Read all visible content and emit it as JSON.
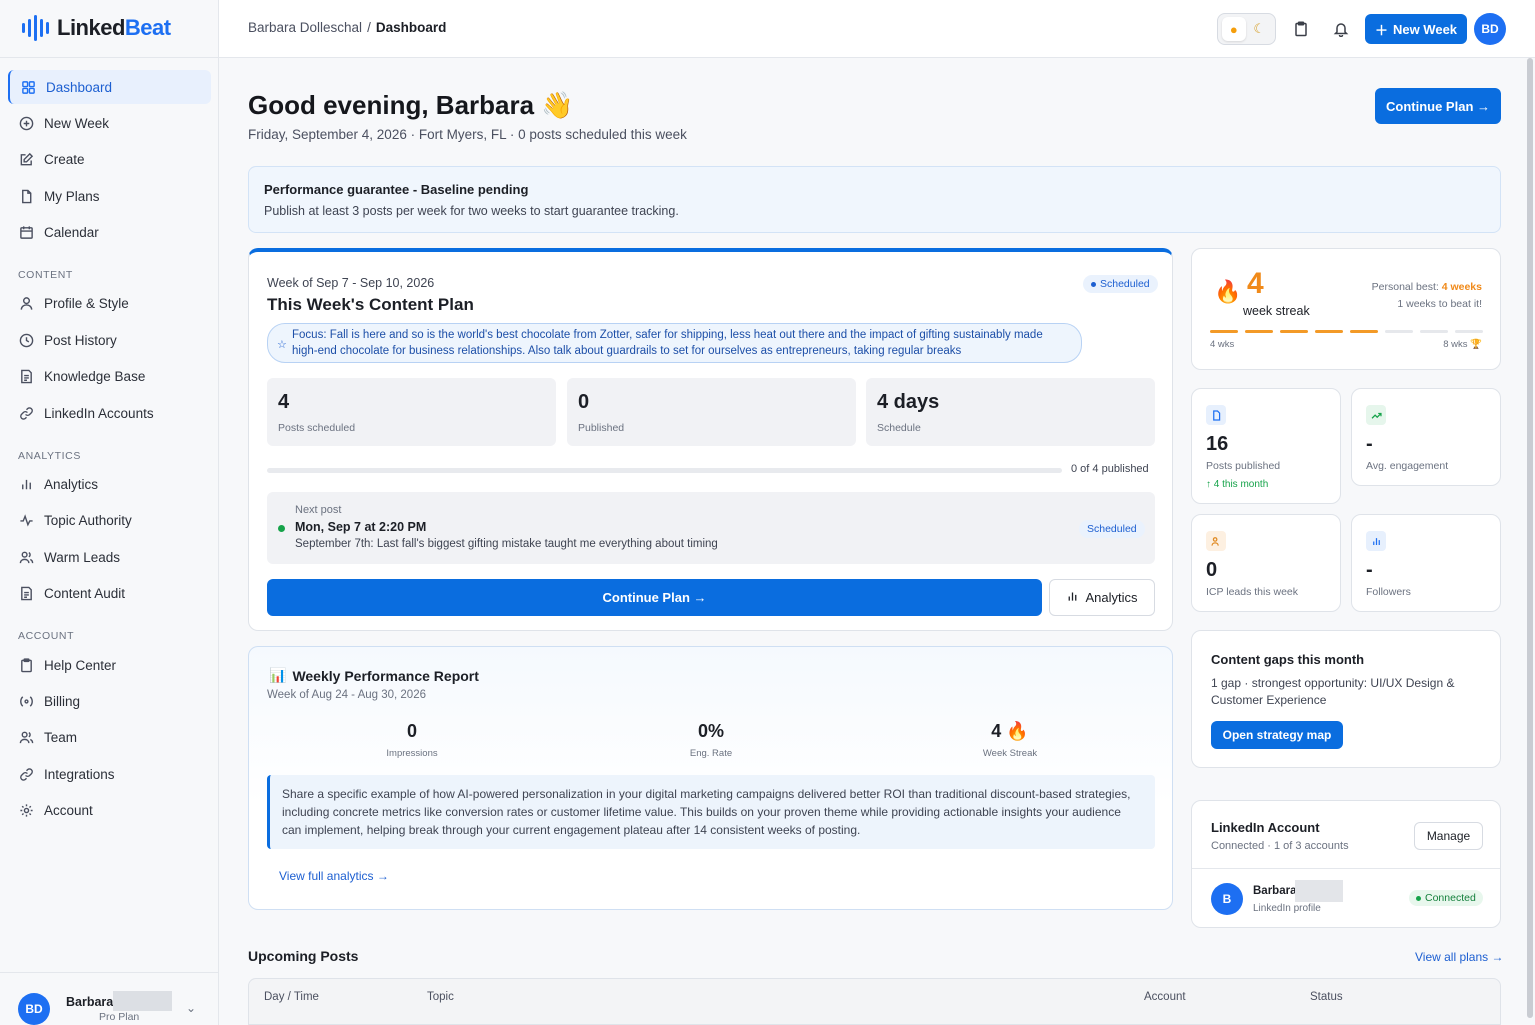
{
  "app": {
    "logo_text": "Linked",
    "logo_accent": "Beat"
  },
  "colors": {
    "accent": "#0a6ddf",
    "streak": "#f08a1a",
    "success": "#16a34a"
  },
  "sidebar": {
    "items": [
      {
        "label": "Dashboard",
        "icon": "grid-icon"
      },
      {
        "label": "New Week",
        "icon": "plus-circle-icon"
      },
      {
        "label": "Create",
        "icon": "edit-icon"
      },
      {
        "label": "My Plans",
        "icon": "document-icon"
      },
      {
        "label": "Calendar",
        "icon": "calendar-icon"
      }
    ],
    "content_section": "CONTENT",
    "content_items": [
      {
        "label": "Profile & Style",
        "icon": "user-icon"
      },
      {
        "label": "Post History",
        "icon": "clock-icon"
      },
      {
        "label": "Knowledge Base",
        "icon": "book-icon"
      },
      {
        "label": "LinkedIn Accounts",
        "icon": "link-icon"
      }
    ],
    "analytics_section": "ANALYTICS",
    "analytics_items": [
      {
        "label": "Analytics",
        "icon": "bar-chart-icon"
      },
      {
        "label": "Topic Authority",
        "icon": "activity-icon"
      },
      {
        "label": "Warm Leads",
        "icon": "users-icon"
      },
      {
        "label": "Content Audit",
        "icon": "file-text-icon"
      }
    ],
    "account_section": "ACCOUNT",
    "account_items": [
      {
        "label": "Help Center",
        "icon": "clipboard-icon"
      },
      {
        "label": "Billing",
        "icon": "billing-icon"
      },
      {
        "label": "Team",
        "icon": "team-icon"
      },
      {
        "label": "Integrations",
        "icon": "link-icon"
      },
      {
        "label": "Account",
        "icon": "gear-icon"
      }
    ],
    "user": {
      "initials": "BD",
      "name": "Barbara",
      "plan": "Pro Plan"
    }
  },
  "topbar": {
    "breadcrumb_parent": "Barbara Dolleschal",
    "breadcrumb_sep": "/",
    "breadcrumb_current": "Dashboard",
    "new_week_label": "New Week",
    "avatar_initials": "BD"
  },
  "main": {
    "greeting": "Good evening, Barbara 👋",
    "subtitle": "Friday, September 4, 2026 · Fort Myers, FL · 0 posts scheduled this week",
    "continue_plan": "Continue Plan →",
    "guarantee": {
      "title": "Performance guarantee - Baseline pending",
      "text": "Publish at least 3 posts per week for two weeks to start guarantee tracking."
    },
    "plan": {
      "week": "Week of Sep 7 - Sep 10, 2026",
      "title": "This Week's Content Plan",
      "status": "Scheduled",
      "focus": "Focus: Fall is here and so is the world's best chocolate from Zotter, safer for shipping, less heat out there and the impact of gifting sustainably made high-end chocolate for business relationships. Also talk about guardrails to set for ourselves as entrepreneurs, taking regular breaks",
      "stats": [
        {
          "value": "4",
          "label": "Posts scheduled"
        },
        {
          "value": "0",
          "label": "Published"
        },
        {
          "value": "4 days",
          "label": "Schedule"
        }
      ],
      "progress": 0,
      "progress_label": "0 of 4 published",
      "next_post_label": "Next post",
      "next_post_time": "Mon, Sep 7 at 2:20 PM",
      "next_post_desc": "September 7th: Last fall's biggest gifting mistake taught me everything about timing",
      "next_post_status": "Scheduled",
      "continue_label": "Continue Plan →",
      "analytics_label": "Analytics"
    },
    "report": {
      "title": "Weekly Performance Report",
      "week": "Week of Aug 24 - Aug 30, 2026",
      "metrics": [
        {
          "value": "0",
          "label": "Impressions"
        },
        {
          "value": "0%",
          "label": "Eng. Rate"
        },
        {
          "value": "4 🔥",
          "label": "Week Streak"
        }
      ],
      "insight": "Share a specific example of how AI-powered personalization in your digital marketing campaigns delivered better ROI than traditional discount-based strategies, including concrete metrics like conversion rates or customer lifetime value. This builds on your proven theme while providing actionable insights your audience can implement, helping break through your current engagement plateau after 14 consistent weeks of posting.",
      "view_full": "View full analytics →"
    },
    "streak": {
      "value": "4",
      "label": "week streak",
      "best_prefix": "Personal best: ",
      "best_value": "4 weeks",
      "beat": "1 weeks to beat it!",
      "filled": 5,
      "total": 8,
      "axis_left": "4 wks",
      "axis_right": "8 wks 🏆"
    },
    "mini_stats": [
      {
        "value": "16",
        "label": "Posts published",
        "sub": "↑ 4 this month",
        "icon": "document-icon"
      },
      {
        "value": "-",
        "label": "Avg. engagement",
        "icon": "trending-up-icon"
      },
      {
        "value": "0",
        "label": "ICP leads this week",
        "icon": "users-icon"
      },
      {
        "value": "-",
        "label": "Followers",
        "icon": "bar-chart-icon"
      }
    ],
    "gaps": {
      "title": "Content gaps this month",
      "desc": "1 gap · strongest opportunity: UI/UX Design & Customer Experience",
      "button": "Open strategy map"
    },
    "linkedin": {
      "title": "LinkedIn Account",
      "subtitle": "Connected · 1 of 3 accounts",
      "manage": "Manage",
      "initial": "B",
      "name": "Barbara",
      "profile": "LinkedIn profile",
      "status": "Connected"
    },
    "upcoming": {
      "title": "Upcoming Posts",
      "view_all": "View all plans →",
      "columns": [
        "Day / Time",
        "Topic",
        "Account",
        "Status"
      ]
    }
  }
}
